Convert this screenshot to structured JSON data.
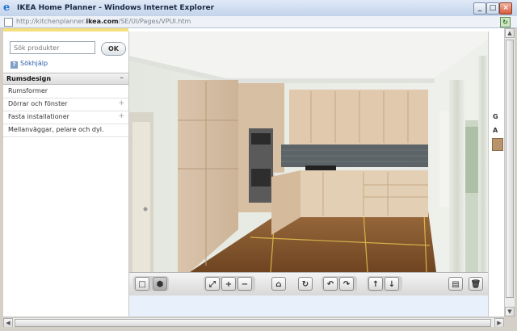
{
  "window": {
    "title": "IKEA Home Planner - Windows Internet Explorer",
    "icon": "ie-icon",
    "controls": {
      "minimize": "_",
      "maximize": "□",
      "close": "×"
    }
  },
  "address_bar": {
    "url_prefix": "http://kitchenplanner.",
    "url_domain": "ikea.com",
    "url_suffix": "/SE/UI/Pages/VPUI.htm"
  },
  "sidebar": {
    "search_placeholder": "Sök produkter",
    "ok_label": "OK",
    "help_label": "Sökhjälp",
    "panel_title": "Rumsdesign",
    "panel_toggle": "–",
    "items": [
      {
        "label": "Rumsformer",
        "expand": ""
      },
      {
        "label": "Dörrar och fönster",
        "expand": "+"
      },
      {
        "label": "Fasta installationer",
        "expand": "+"
      },
      {
        "label": "Mellanväggar, pelare och dyl.",
        "expand": ""
      }
    ]
  },
  "right_panel": {
    "letter_g": "G",
    "letter_a": "A"
  },
  "toolbar": {
    "view2d": "□",
    "view3d": "⬢",
    "zoom_fit": "⤢",
    "zoom_in": "+",
    "zoom_out": "−",
    "home": "⌂",
    "rotate": "↻",
    "pan_left": "↶",
    "pan_right": "↷",
    "tilt_up": "↑",
    "tilt_down": "↓",
    "print": "▤",
    "delete": "🗑"
  },
  "scroll": {
    "up": "▲",
    "down": "▼",
    "left": "◀",
    "right": "▶"
  }
}
